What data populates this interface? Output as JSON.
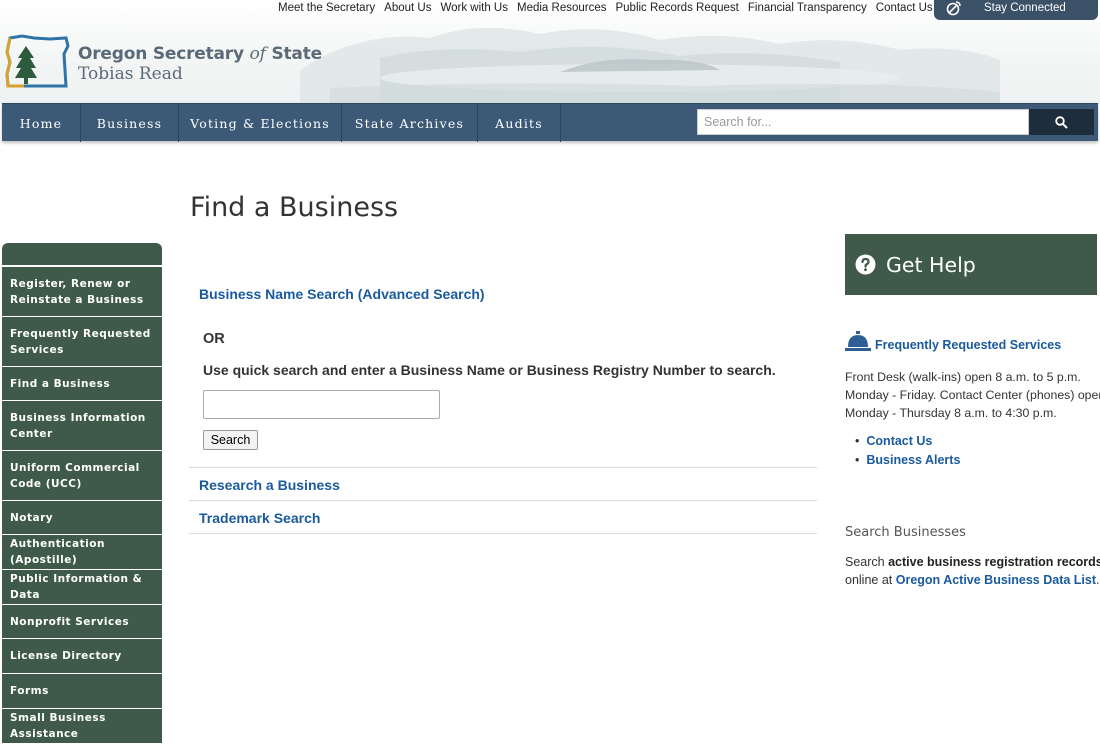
{
  "utility_nav": [
    "Meet the Secretary",
    "About Us",
    "Work with Us",
    "Media Resources",
    "Public Records Request",
    "Financial Transparency",
    "Contact Us"
  ],
  "stay_connected": "Stay Connected",
  "site": {
    "title_pre": "Oregon Secretary ",
    "title_of": "of",
    "title_post": " State",
    "subtitle": "Tobias Read"
  },
  "main_nav": [
    "Home",
    "Business",
    "Voting & Elections",
    "State Archives",
    "Audits"
  ],
  "search": {
    "placeholder": "Search for..."
  },
  "page_title": "Find a Business",
  "sidebar": [
    "Register, Renew or Reinstate a Business",
    "Frequently Requested Services",
    "Find a Business",
    "Business Information Center",
    "Uniform Commercial Code (UCC)",
    "Notary",
    "Authentication (Apostille)",
    "Public Information & Data",
    "Nonprofit Services",
    "License Directory",
    "Forms",
    "Small Business Assistance"
  ],
  "content": {
    "advanced_search": "Business Name Search (Advanced Search)",
    "or_label": "OR",
    "quick_instructions": "Use quick search and enter a Business Name or Business Registry Number to search.",
    "search_button": "Search",
    "research_link": "Research a Business",
    "trademark_link": "Trademark Search"
  },
  "help": {
    "title": "Get Help",
    "frs_link": "Frequently Requested Services",
    "hours": [
      "Front Desk (walk-ins) open 8 a.m. to 5 p.m.",
      "Monday - Friday. Contact Center (phones) open",
      "Monday - Thursday 8 a.m. to 4:30 p.m."
    ],
    "links": [
      "Contact Us",
      "Business Alerts"
    ],
    "search_heading": "Search Businesses",
    "search_text_1": "Search ",
    "search_text_bold": "active business registration records",
    "search_text_2": "online at ",
    "search_text_link": "Oregon Active Business Data List",
    "search_text_end": "."
  },
  "colors": {
    "nav_blue": "#3c5a78",
    "sidebar_green": "#3f5a48",
    "link_blue": "#1a5a9e"
  }
}
